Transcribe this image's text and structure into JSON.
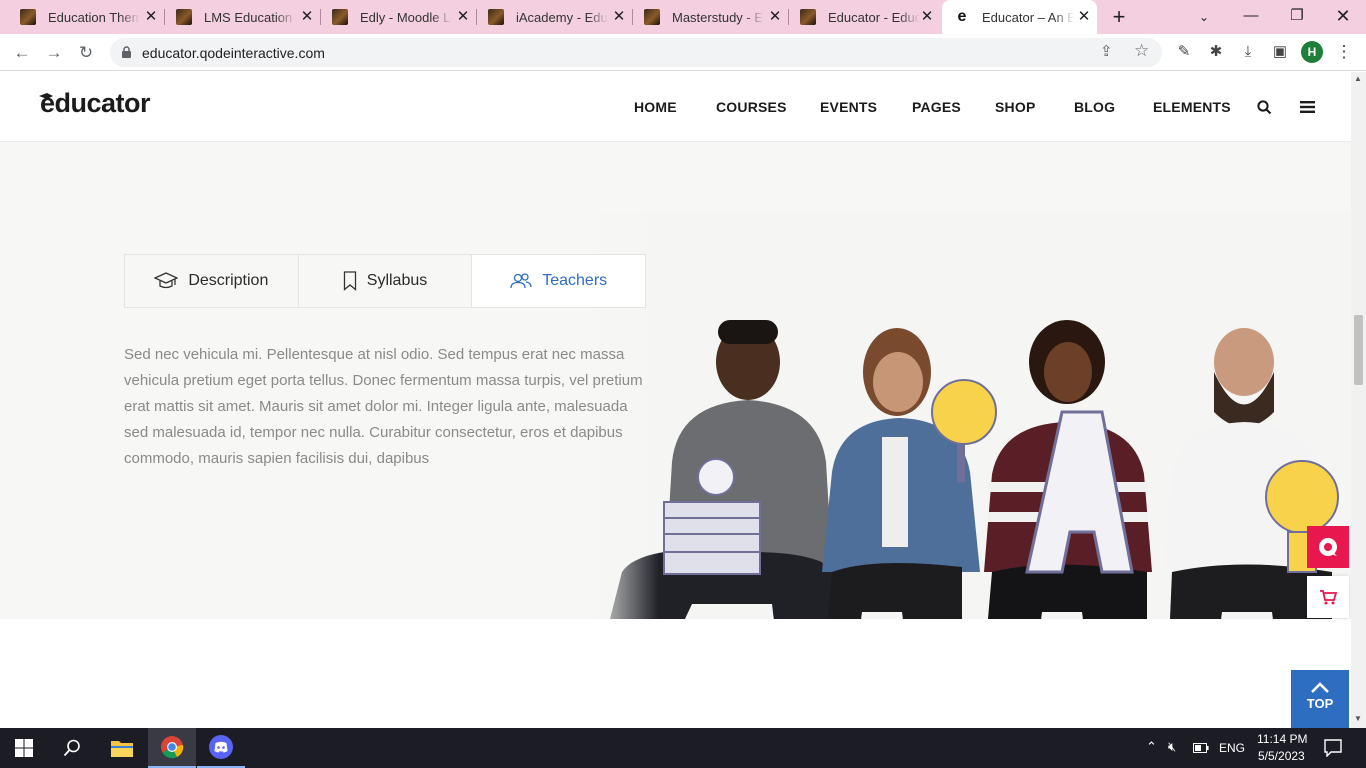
{
  "browser": {
    "tabs": [
      {
        "title": "Education Theme"
      },
      {
        "title": "LMS Education Theme"
      },
      {
        "title": "Edly - Moodle LMS"
      },
      {
        "title": "iAcademy - Education"
      },
      {
        "title": "Masterstudy - Education"
      },
      {
        "title": "Educator - Education"
      },
      {
        "title": "Educator – An Education"
      }
    ],
    "url": "educator.qodeinteractive.com",
    "profile_initial": "H"
  },
  "site": {
    "logo": "educator",
    "nav": [
      "HOME",
      "COURSES",
      "EVENTS",
      "PAGES",
      "SHOP",
      "BLOG",
      "ELEMENTS"
    ],
    "course_tabs": [
      {
        "label": "Description",
        "icon": "graduation-cap-icon"
      },
      {
        "label": "Syllabus",
        "icon": "bookmark-icon"
      },
      {
        "label": "Teachers",
        "icon": "people-icon",
        "active": true
      }
    ],
    "description": "Sed nec vehicula mi. Pellentesque at nisl odio. Sed tempus erat nec massa vehicula pretium eget porta tellus. Donec fermentum massa turpis, vel pretium erat mattis sit amet. Mauris sit amet dolor mi. Integer ligula ante, malesuada sed malesuada id, tempor nec nulla. Curabitur consectetur, eros et dapibus commodo, mauris sapien facilisis dui, dapibus",
    "back_to_top": "TOP",
    "accent_color": "#2e6ec0",
    "side_widget_color": "#e8184f"
  },
  "taskbar": {
    "language": "ENG",
    "time": "11:14 PM",
    "date": "5/5/2023"
  }
}
